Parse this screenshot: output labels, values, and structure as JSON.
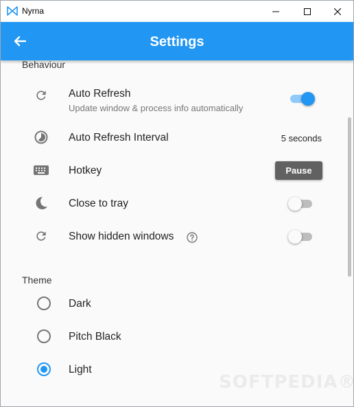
{
  "window": {
    "title": "Nyrna"
  },
  "appbar": {
    "title": "Settings"
  },
  "behaviour": {
    "header": "Behaviour",
    "auto_refresh": {
      "title": "Auto Refresh",
      "subtitle": "Update window & process info automatically",
      "enabled": true
    },
    "auto_refresh_interval": {
      "title": "Auto Refresh Interval",
      "value": "5 seconds"
    },
    "hotkey": {
      "title": "Hotkey",
      "value": "Pause"
    },
    "close_to_tray": {
      "title": "Close to tray",
      "enabled": false
    },
    "show_hidden_windows": {
      "title": "Show hidden windows",
      "enabled": false
    }
  },
  "theme": {
    "header": "Theme",
    "options": [
      {
        "label": "Dark",
        "selected": false
      },
      {
        "label": "Pitch Black",
        "selected": false
      },
      {
        "label": "Light",
        "selected": true
      }
    ]
  },
  "watermark": "SOFTPEDIA®",
  "colors": {
    "accent": "#2196f3",
    "icon": "#757575"
  }
}
